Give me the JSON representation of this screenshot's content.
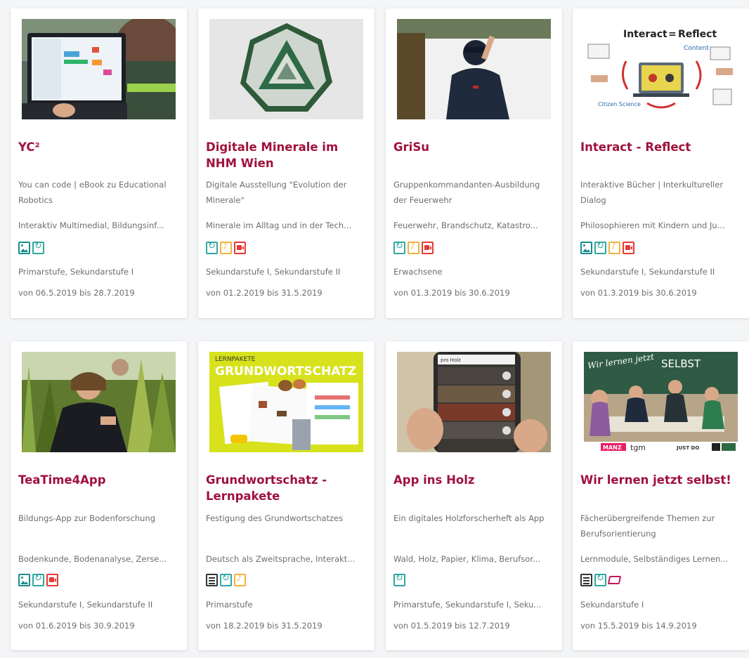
{
  "cards": [
    {
      "title": "YC²",
      "description": "You can code | eBook zu Educational Robotics",
      "tags": "Interaktiv Multimedial, Bildungsinf...",
      "icons": [
        "image-icon",
        "interactive-icon"
      ],
      "level": "Primarstufe, Sekundarstufe I",
      "dates": "von 06.5.2019 bis 28.7.2019"
    },
    {
      "title": "Digitale Minerale im NHM Wien",
      "description": "Digitale Ausstellung \"Evolution der Minerale\"",
      "tags": "Minerale im Alltag und in der Tech...",
      "icons": [
        "interactive-icon",
        "audio-icon",
        "video-icon"
      ],
      "level": "Sekundarstufe I, Sekundarstufe II",
      "dates": "von 01.2.2019 bis 31.5.2019"
    },
    {
      "title": "GriSu",
      "description": "Gruppenkommandanten-Ausbildung der Feuerwehr",
      "tags": "Feuerwehr, Brandschutz, Katastro...",
      "icons": [
        "interactive-icon",
        "audio-icon",
        "video-icon"
      ],
      "level": "Erwachsene",
      "dates": "von 01.3.2019 bis 30.6.2019"
    },
    {
      "title": "Interact - Reflect",
      "description": "Interaktive Bücher | Interkultureller Dialog",
      "tags": "Philosophieren mit Kindern und Ju...",
      "icons": [
        "image-icon",
        "interactive-icon",
        "audio-icon",
        "video-icon"
      ],
      "level": "Sekundarstufe I, Sekundarstufe II",
      "dates": "von 01.3.2019 bis 30.6.2019"
    },
    {
      "title": "TeaTime4App",
      "description": "Bildungs-App zur Bodenforschung",
      "tags": "Bodenkunde, Bodenanalyse, Zerse...",
      "icons": [
        "image-icon",
        "interactive-icon",
        "video-icon"
      ],
      "level": "Sekundarstufe I, Sekundarstufe II",
      "dates": "von 01.6.2019 bis 30.9.2019"
    },
    {
      "title": "Grundwortschatz - Lernpakete",
      "description": "Festigung des Grundwortschatzes",
      "tags": "Deutsch als Zweitsprache, Interakt...",
      "icons": [
        "document-icon",
        "interactive-icon",
        "audio-icon"
      ],
      "level": "Primarstufe",
      "dates": "von 18.2.2019 bis 31.5.2019"
    },
    {
      "title": "App ins Holz",
      "description": "Ein digitales Holzforscherheft als App",
      "tags": "Wald, Holz, Papier, Klima, Berufsor...",
      "icons": [
        "interactive-icon"
      ],
      "level": "Primarstufe, Sekundarstufe I, Seku...",
      "dates": "von 01.5.2019 bis 12.7.2019"
    },
    {
      "title": "Wir lernen jetzt selbst!",
      "description": "Fächerübergreifende Themen zur Berufsorientierung",
      "tags": "Lernmodule, Selbständiges Lernen...",
      "icons": [
        "document-icon",
        "interactive-icon",
        "folder-icon"
      ],
      "level": "Sekundarstufe I",
      "dates": "von 15.5.2019 bis 14.9.2019"
    }
  ],
  "thumbnails": {
    "interact_reflect": {
      "line1": "Interact",
      "line2": "Reflect",
      "small": [
        "Content",
        "Citizen Science"
      ]
    },
    "grundwortschatz": {
      "header_small": "LERNPAKETE",
      "header_big": "GRUNDWORTSCHATZ"
    },
    "app_ins_holz": {
      "screen_title": "pro Holz"
    },
    "wir_lernen": {
      "board": "Wir lernen jetzt",
      "board_big": "SELBST",
      "footer_brand1": "MANZ",
      "footer_brand2": "tgm",
      "footer_brand3": "JUST DO"
    }
  },
  "colors": {
    "title": "#a0123e",
    "text": "#6e6e6e",
    "background": "#f4f5f7"
  }
}
